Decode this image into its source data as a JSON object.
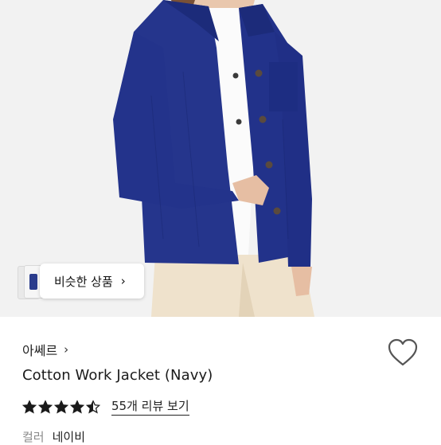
{
  "product_image": {
    "similar_products_label": "비슷한 상품",
    "similar_chevron": "›"
  },
  "product": {
    "brand": "아쎄르",
    "brand_chevron": "›",
    "title": "Cotton Work Jacket (Navy)",
    "rating": 4.5,
    "review_link": "55개 리뷰 보기",
    "color_label": "컬러",
    "color_value": "네이비"
  },
  "colors": {
    "jacket_navy": "#22338a",
    "star": "#1a1a1a"
  },
  "icons": {
    "wishlist": "heart-outline-icon"
  }
}
